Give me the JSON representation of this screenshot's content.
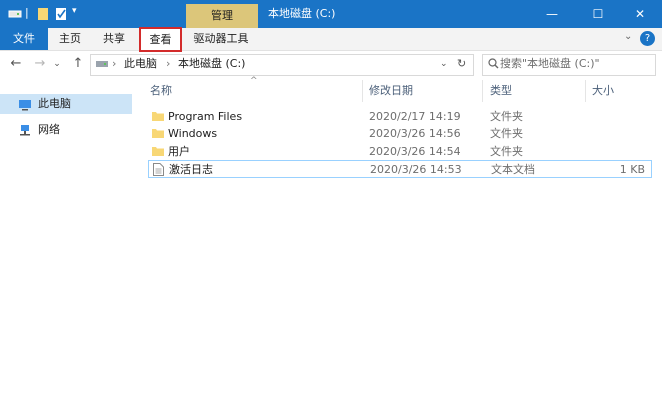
{
  "window": {
    "title": "本地磁盘 (C:)",
    "contextual_tab": "管理",
    "controls": {
      "minimize": "—",
      "maximize": "☐",
      "close": "✕"
    }
  },
  "ribbon": {
    "tabs": [
      "文件",
      "主页",
      "共享",
      "查看",
      "驱动器工具"
    ],
    "highlighted_tab": "查看"
  },
  "address_bar": {
    "breadcrumbs": [
      "此电脑",
      "本地磁盘 (C:)"
    ],
    "search_placeholder": "搜索\"本地磁盘 (C:)\""
  },
  "sidebar": {
    "items": [
      {
        "label": "此电脑",
        "icon": "computer-icon",
        "selected": true
      },
      {
        "label": "网络",
        "icon": "network-icon",
        "selected": false
      }
    ]
  },
  "file_list": {
    "columns": [
      "名称",
      "修改日期",
      "类型",
      "大小"
    ],
    "rows": [
      {
        "name": "Program Files",
        "modified": "2020/2/17 14:19",
        "type": "文件夹",
        "size": "",
        "icon": "folder-icon"
      },
      {
        "name": "Windows",
        "modified": "2020/3/26 14:56",
        "type": "文件夹",
        "size": "",
        "icon": "folder-icon"
      },
      {
        "name": "用户",
        "modified": "2020/3/26 14:54",
        "type": "文件夹",
        "size": "",
        "icon": "folder-icon"
      },
      {
        "name": "激活日志",
        "modified": "2020/3/26 14:53",
        "type": "文本文档",
        "size": "1 KB",
        "icon": "text-file-icon"
      }
    ]
  },
  "colors": {
    "title_bar": "#1a74c6",
    "contextual_tab": "#dcc67a",
    "selection": "#cce4f7",
    "highlight_border": "#d32b2b",
    "folder": "#f8d775"
  }
}
